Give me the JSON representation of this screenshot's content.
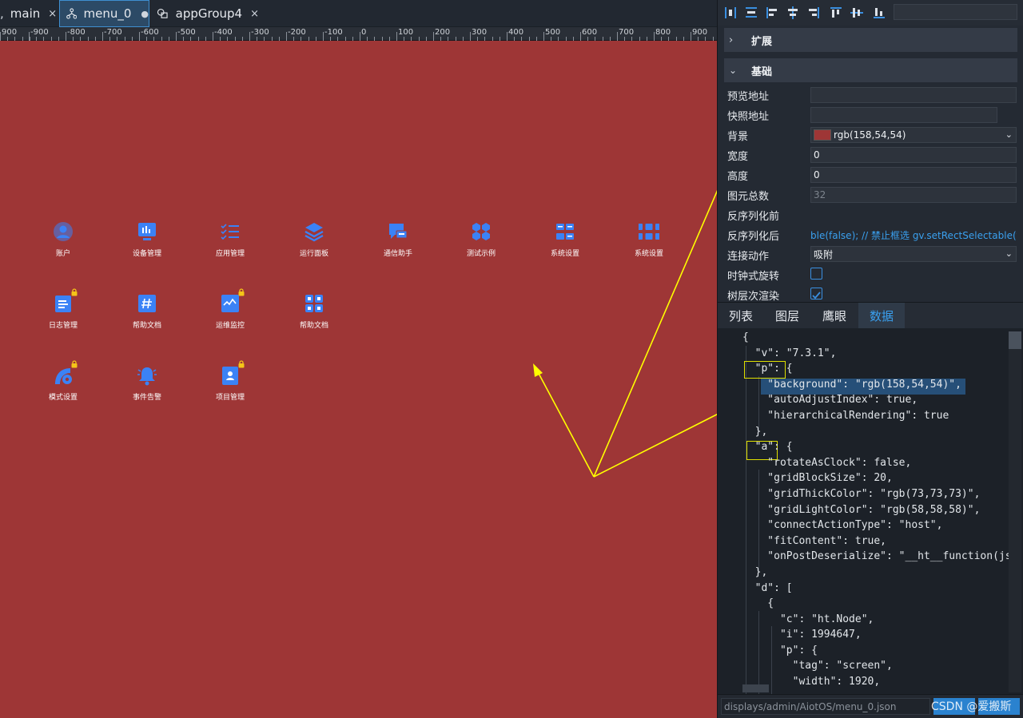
{
  "tabs": [
    {
      "label": "main",
      "marker": "×"
    },
    {
      "label": "menu_0",
      "marker": "●"
    },
    {
      "label": "appGroup4",
      "marker": "×"
    }
  ],
  "ruler_labels": [
    "900",
    "-900",
    "-800",
    "-700",
    "-600",
    "-500",
    "-400",
    "-300",
    "-200",
    "-100",
    "0",
    "100",
    "200",
    "300",
    "400",
    "500",
    "600",
    "700",
    "800",
    "900"
  ],
  "canvas": {
    "background": "#9e3636",
    "icon_color": "#3b82f6",
    "lock_color": "#f5c518",
    "items": [
      {
        "label": "账户",
        "icon": "user-icon",
        "locked": false
      },
      {
        "label": "设备管理",
        "icon": "monitor-icon",
        "locked": false
      },
      {
        "label": "应用管理",
        "icon": "checklist-icon",
        "locked": false
      },
      {
        "label": "运行面板",
        "icon": "layers-icon",
        "locked": false
      },
      {
        "label": "通信助手",
        "icon": "chat-icon",
        "locked": false
      },
      {
        "label": "测试示例",
        "icon": "cubes-icon",
        "locked": false
      },
      {
        "label": "系统设置",
        "icon": "grid-settings-icon",
        "locked": false
      },
      {
        "label": "系统设置",
        "icon": "grid-settings-wide-icon",
        "locked": false
      },
      {
        "label": "日志管理",
        "icon": "log-icon",
        "locked": true
      },
      {
        "label": "帮助文档",
        "icon": "hash-doc-icon",
        "locked": false
      },
      {
        "label": "运维监控",
        "icon": "monitor-chart-icon",
        "locked": true
      },
      {
        "label": "帮助文档",
        "icon": "apps-grid-icon",
        "locked": false
      },
      {
        "label": "模式设置",
        "icon": "mode-gear-icon",
        "locked": true
      },
      {
        "label": "事件告警",
        "icon": "bell-icon",
        "locked": false
      },
      {
        "label": "项目管理",
        "icon": "project-icon",
        "locked": true
      }
    ]
  },
  "panel": {
    "sections": [
      {
        "label": "扩展",
        "expanded": false
      },
      {
        "label": "基础",
        "expanded": true
      }
    ],
    "props": {
      "preview_url": {
        "label": "预览地址",
        "value": ""
      },
      "snapshot_url": {
        "label": "快照地址",
        "value": ""
      },
      "background": {
        "label": "背景",
        "value": "rgb(158,54,54)",
        "swatch": "#9e3636"
      },
      "width": {
        "label": "宽度",
        "value": "0"
      },
      "height": {
        "label": "高度",
        "value": "0"
      },
      "total": {
        "label": "图元总数",
        "value": "32"
      },
      "pre_deserialize": {
        "label": "反序列化前",
        "value": ""
      },
      "post_deserialize": {
        "label": "反序列化后",
        "value": "ble(false); // 禁止框选 gv.setRectSelectable(fals"
      },
      "connect_action": {
        "label": "连接动作",
        "value": "吸附"
      },
      "clockwise": {
        "label": "时钟式旋转",
        "checked": false
      },
      "hierarchical": {
        "label": "树层次渲染",
        "checked": true
      }
    },
    "lower_tabs": [
      "列表",
      "图层",
      "鹰眼",
      "数据"
    ],
    "active_lower_tab": "数据",
    "code_lines": [
      "{",
      "  \"v\": \"7.3.1\",",
      "  \"p\": {",
      "    \"background\": \"rgb(158,54,54)\",",
      "    \"autoAdjustIndex\": true,",
      "    \"hierarchicalRendering\": true",
      "  },",
      "  \"a\": {",
      "    \"rotateAsClock\": false,",
      "    \"gridBlockSize\": 20,",
      "    \"gridThickColor\": \"rgb(73,73,73)\",",
      "    \"gridLightColor\": \"rgb(58,58,58)\",",
      "    \"connectActionType\": \"host\",",
      "    \"fitContent\": true,",
      "    \"onPostDeserialize\": \"__ht__function(jsc",
      "  },",
      "  \"d\": [",
      "    {",
      "      \"c\": \"ht.Node\",",
      "      \"i\": 1994647,",
      "      \"p\": {",
      "        \"tag\": \"screen\",",
      "        \"width\": 1920,"
    ],
    "file_path": "displays/admin/AiotOS/menu_0.json",
    "watermark": "CSDN @爱搬斯"
  },
  "annotation_color": "#ffff00"
}
